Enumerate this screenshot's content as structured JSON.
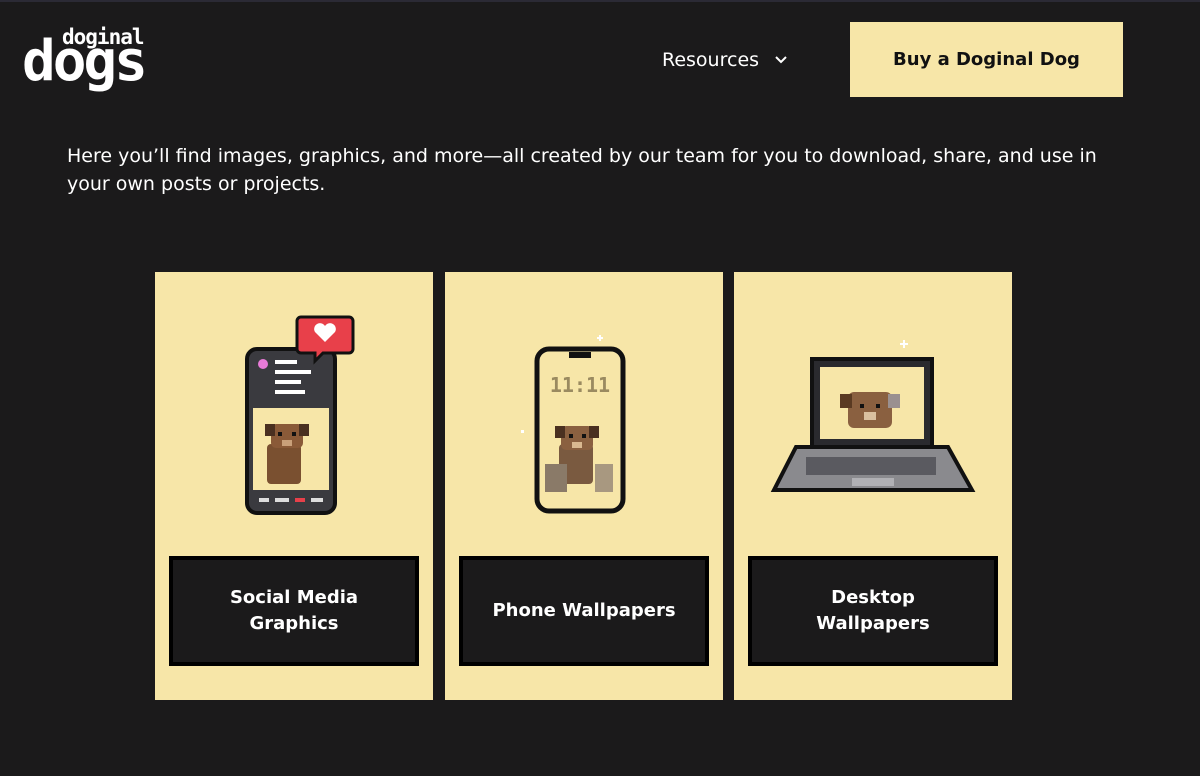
{
  "header": {
    "logo_small": "doginal",
    "logo_big": "dogs",
    "nav_resources": "Resources",
    "buy_button": "Buy a Doginal Dog"
  },
  "intro_text": "Here you’ll find images, graphics, and more—all created by our team for you to download, share, and use in your own posts or projects.",
  "cards": [
    {
      "label": "Social Media Graphics",
      "icon": "social-phone-illustration"
    },
    {
      "label": "Phone Wallpapers",
      "icon": "phone-wallpaper-illustration",
      "clock": "11:11"
    },
    {
      "label": "Desktop Wallpapers",
      "icon": "laptop-illustration"
    }
  ],
  "colors": {
    "background": "#1b1a1b",
    "accent": "#f7e6a8",
    "heart": "#e8404a"
  }
}
